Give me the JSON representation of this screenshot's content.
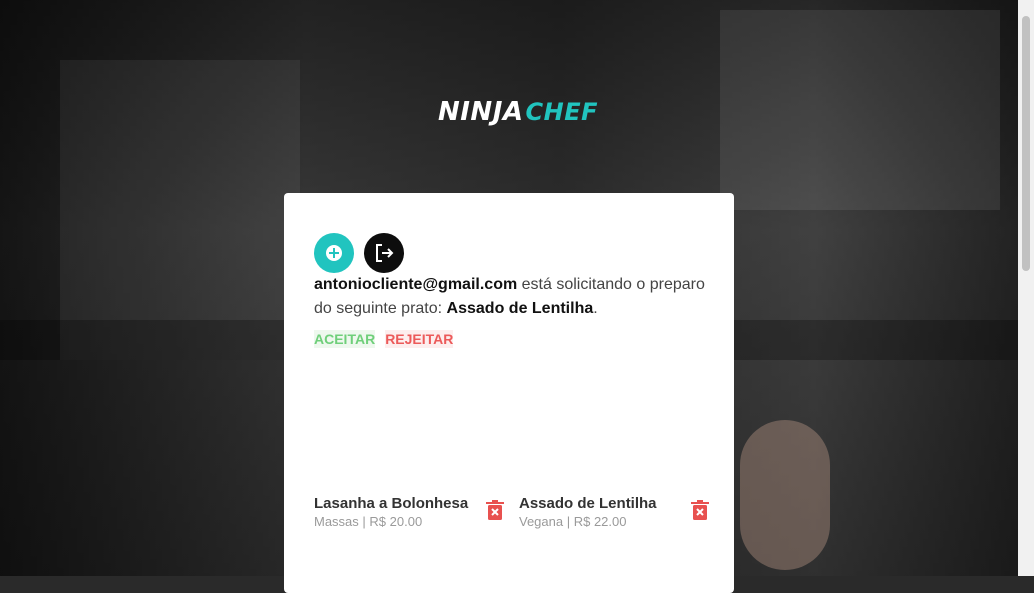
{
  "logo": {
    "part1": "NINJA",
    "part2": "CHEF"
  },
  "colors": {
    "accent": "#21c4bf",
    "accept": "#6fcf7a",
    "reject": "#ec5a5a",
    "trash": "#e8514f"
  },
  "toolbar": {
    "add_icon": "plus-circle-icon",
    "logout_icon": "logout-icon"
  },
  "request": {
    "email": "antoniocliente@gmail.com",
    "text_before": " está solicitando o preparo do seguinte prato: ",
    "dish": "Assado de Lentilha",
    "text_after": "."
  },
  "actions": {
    "accept_label": "ACEITAR",
    "reject_label": "REJEITAR"
  },
  "dishes": [
    {
      "name": "Lasanha a Bolonhesa",
      "category": "Massas",
      "price": "R$ 20.00"
    },
    {
      "name": "Assado de Lentilha",
      "category": "Vegana",
      "price": "R$ 22.00"
    }
  ],
  "separator": " | "
}
